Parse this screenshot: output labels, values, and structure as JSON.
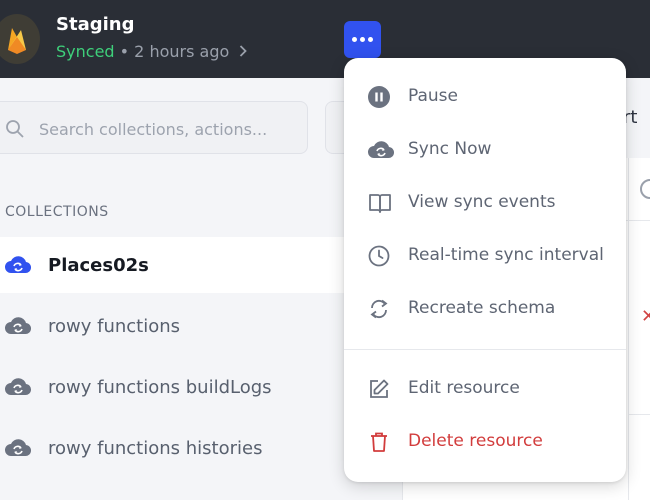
{
  "header": {
    "title": "Staging",
    "status": "Synced",
    "separator": " • ",
    "time": "2 hours ago",
    "avatar_icon": "firebase-flame-icon",
    "chevron_icon": "chevron-right-icon",
    "more_icon": "more-horizontal-icon"
  },
  "search": {
    "placeholder": "Search collections, actions..."
  },
  "collections": {
    "section_label": "COLLECTIONS",
    "items": [
      {
        "label": "Places02s",
        "selected": true
      },
      {
        "label": "rowy functions",
        "selected": false
      },
      {
        "label": "rowy functions buildLogs",
        "selected": false
      },
      {
        "label": "rowy functions histories",
        "selected": false
      }
    ]
  },
  "background": {
    "port_text": "ort",
    "x_mark": "✕"
  },
  "menu": {
    "items": [
      {
        "label": "Pause",
        "icon": "pause-circle-icon"
      },
      {
        "label": "Sync Now",
        "icon": "cloud-sync-icon"
      },
      {
        "label": "View sync events",
        "icon": "book-open-icon"
      },
      {
        "label": "Real-time sync interval",
        "icon": "clock-icon"
      },
      {
        "label": "Recreate schema",
        "icon": "refresh-icon"
      },
      {
        "label": "Edit resource",
        "icon": "edit-pencil-icon"
      },
      {
        "label": "Delete resource",
        "icon": "trash-icon"
      }
    ]
  },
  "colors": {
    "accent": "#3152ef",
    "synced": "#3ecf7a",
    "danger": "#d23c3c",
    "header_bg": "#2a2e36"
  }
}
